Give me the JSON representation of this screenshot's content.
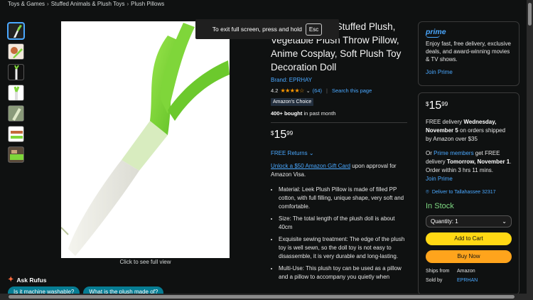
{
  "breadcrumb": [
    "Toys & Games",
    "Stuffed Animals & Plush Toys",
    "Plush Pillows"
  ],
  "fullscreen_notice": {
    "text": "To exit full screen, press and hold",
    "key": "Esc"
  },
  "image": {
    "see_full": "Click to see full view"
  },
  "rufus": {
    "label": "Ask Rufus",
    "chips": [
      "Is it machine washable?",
      "What is the plush made of?"
    ]
  },
  "product": {
    "title": "on Leek Onion Stuffed Plush, Vegetable Plush Throw Pillow, Anime Cosplay, Soft Plush Toy Decoration Doll",
    "brand": "Brand: EPRHAY",
    "rating": "4.2",
    "stars": "★★★★☆",
    "reviews": "(64)",
    "search_link": "Search this page",
    "badge": "Amazon's Choice",
    "bought_bold": "400+ bought",
    "bought_rest": " in past month",
    "price_symbol": "$",
    "price_whole": "15",
    "price_cents": "99",
    "returns": "FREE Returns",
    "unlock_link": "Unlock a $50 Amazon Gift Card",
    "unlock_rest": " upon approval for Amazon Visa.",
    "bullets": [
      "Material: Leek Plush Pillow is made of filled PP cotton, with full filling, unique shape, very soft and comfortable.",
      "Size: The total length of the plush doll is about 40cm",
      "Exquisite sewing treatment: The edge of the plush toy is well sewn, so the doll toy is not easy to disassemble, it is very durable and long-lasting.",
      "Multi-Use: This plush toy can be used as a pillow and a pillow to accompany you quietly when"
    ]
  },
  "prime": {
    "logo": "prime",
    "text": "Enjoy fast, free delivery, exclusive deals, and award-winning movies & TV shows.",
    "join": "Join Prime"
  },
  "buybox": {
    "price_symbol": "$",
    "price_whole": "15",
    "price_cents": "99",
    "delivery_pre": "FREE delivery ",
    "delivery_date": "Wednesday, November 5",
    "delivery_post": " on orders shipped by Amazon over $35",
    "or": "Or ",
    "prime_members": "Prime members",
    "fast_pre": " get FREE delivery ",
    "fast_date": "Tomorrow, November 1",
    "fast_post": ". Order within 3 hrs 11 mins.",
    "join_prime": "Join Prime",
    "deliver_to": "Deliver to Tallahassee 32317",
    "stock": "In Stock",
    "quantity": "Quantity:  1",
    "add_to_cart": "Add to Cart",
    "buy_now": "Buy Now",
    "ships_from_label": "Ships from",
    "ships_from_value": "Amazon",
    "sold_by_label": "Sold by",
    "sold_by_value": "EPRHAN"
  },
  "colors": {
    "accent": "#4aa8ff",
    "cart": "#ffd814",
    "buy": "#ffa41c",
    "stock": "#7fda83",
    "leek_green": "#7fd63a"
  }
}
